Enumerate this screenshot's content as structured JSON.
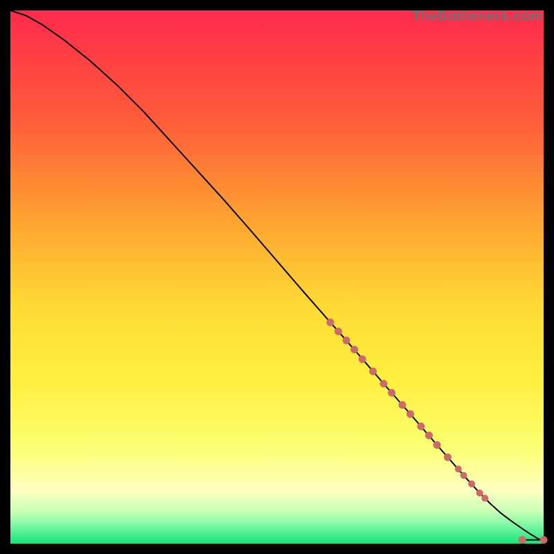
{
  "watermark": "TheBottleneck.com",
  "colors": {
    "background": "#000000",
    "curve": "#000000",
    "marker_fill": "#cc6a6a",
    "marker_stroke": "#cc6a6a"
  },
  "chart_data": {
    "type": "line",
    "title": "",
    "xlabel": "",
    "ylabel": "",
    "xlim": [
      0,
      100
    ],
    "ylim": [
      0,
      100
    ],
    "gradient": {
      "note": "vertical gradient by y-value, top=100 bottom=0",
      "stops": [
        {
          "y": 100,
          "color": "#ff2a4d"
        },
        {
          "y": 80,
          "color": "#ff5a3a"
        },
        {
          "y": 60,
          "color": "#ffa530"
        },
        {
          "y": 45,
          "color": "#ffd934"
        },
        {
          "y": 30,
          "color": "#fff040"
        },
        {
          "y": 18,
          "color": "#fbff72"
        },
        {
          "y": 10,
          "color": "#fdffc0"
        },
        {
          "y": 6,
          "color": "#c8ffb4"
        },
        {
          "y": 3,
          "color": "#70f5a0"
        },
        {
          "y": 0,
          "color": "#17e37a"
        }
      ]
    },
    "series": [
      {
        "name": "bottleneck-curve",
        "x": [
          0,
          3,
          6,
          10,
          15,
          20,
          25,
          30,
          35,
          40,
          45,
          50,
          55,
          60,
          65,
          70,
          75,
          80,
          85,
          88,
          90,
          92,
          94,
          96,
          97.5,
          99,
          100
        ],
        "y": [
          100,
          99,
          97.3,
          94.5,
          90.5,
          86,
          81,
          75.5,
          70,
          64.5,
          58.8,
          53,
          47.2,
          41.5,
          35.8,
          30,
          24.3,
          18.5,
          12.8,
          9.5,
          7.5,
          5.7,
          4.2,
          2.8,
          1.8,
          0.9,
          0.5
        ]
      },
      {
        "name": "tail-hook",
        "x": [
          96,
          100
        ],
        "y": [
          0.7,
          0.7
        ]
      }
    ],
    "scatter": {
      "name": "marked-points",
      "points": [
        {
          "x": 60,
          "y": 41.5,
          "r": 5
        },
        {
          "x": 61.5,
          "y": 39.8,
          "r": 5
        },
        {
          "x": 63,
          "y": 38.1,
          "r": 5
        },
        {
          "x": 64.5,
          "y": 36.4,
          "r": 5
        },
        {
          "x": 66,
          "y": 34.6,
          "r": 5
        },
        {
          "x": 68,
          "y": 32.3,
          "r": 5
        },
        {
          "x": 70,
          "y": 30.0,
          "r": 5
        },
        {
          "x": 71.5,
          "y": 28.3,
          "r": 5
        },
        {
          "x": 73.5,
          "y": 26.0,
          "r": 5
        },
        {
          "x": 75,
          "y": 24.3,
          "r": 5
        },
        {
          "x": 77,
          "y": 22.0,
          "r": 5
        },
        {
          "x": 78.5,
          "y": 20.3,
          "r": 5
        },
        {
          "x": 80,
          "y": 18.5,
          "r": 5
        },
        {
          "x": 82,
          "y": 16.2,
          "r": 5
        },
        {
          "x": 84,
          "y": 14.0,
          "r": 4.5
        },
        {
          "x": 85,
          "y": 12.8,
          "r": 4.5
        },
        {
          "x": 86.5,
          "y": 11.2,
          "r": 4.5
        },
        {
          "x": 88,
          "y": 9.5,
          "r": 4.5
        },
        {
          "x": 89,
          "y": 8.5,
          "r": 4.5
        },
        {
          "x": 96,
          "y": 0.7,
          "r": 5
        },
        {
          "x": 100,
          "y": 0.7,
          "r": 5
        }
      ]
    }
  }
}
